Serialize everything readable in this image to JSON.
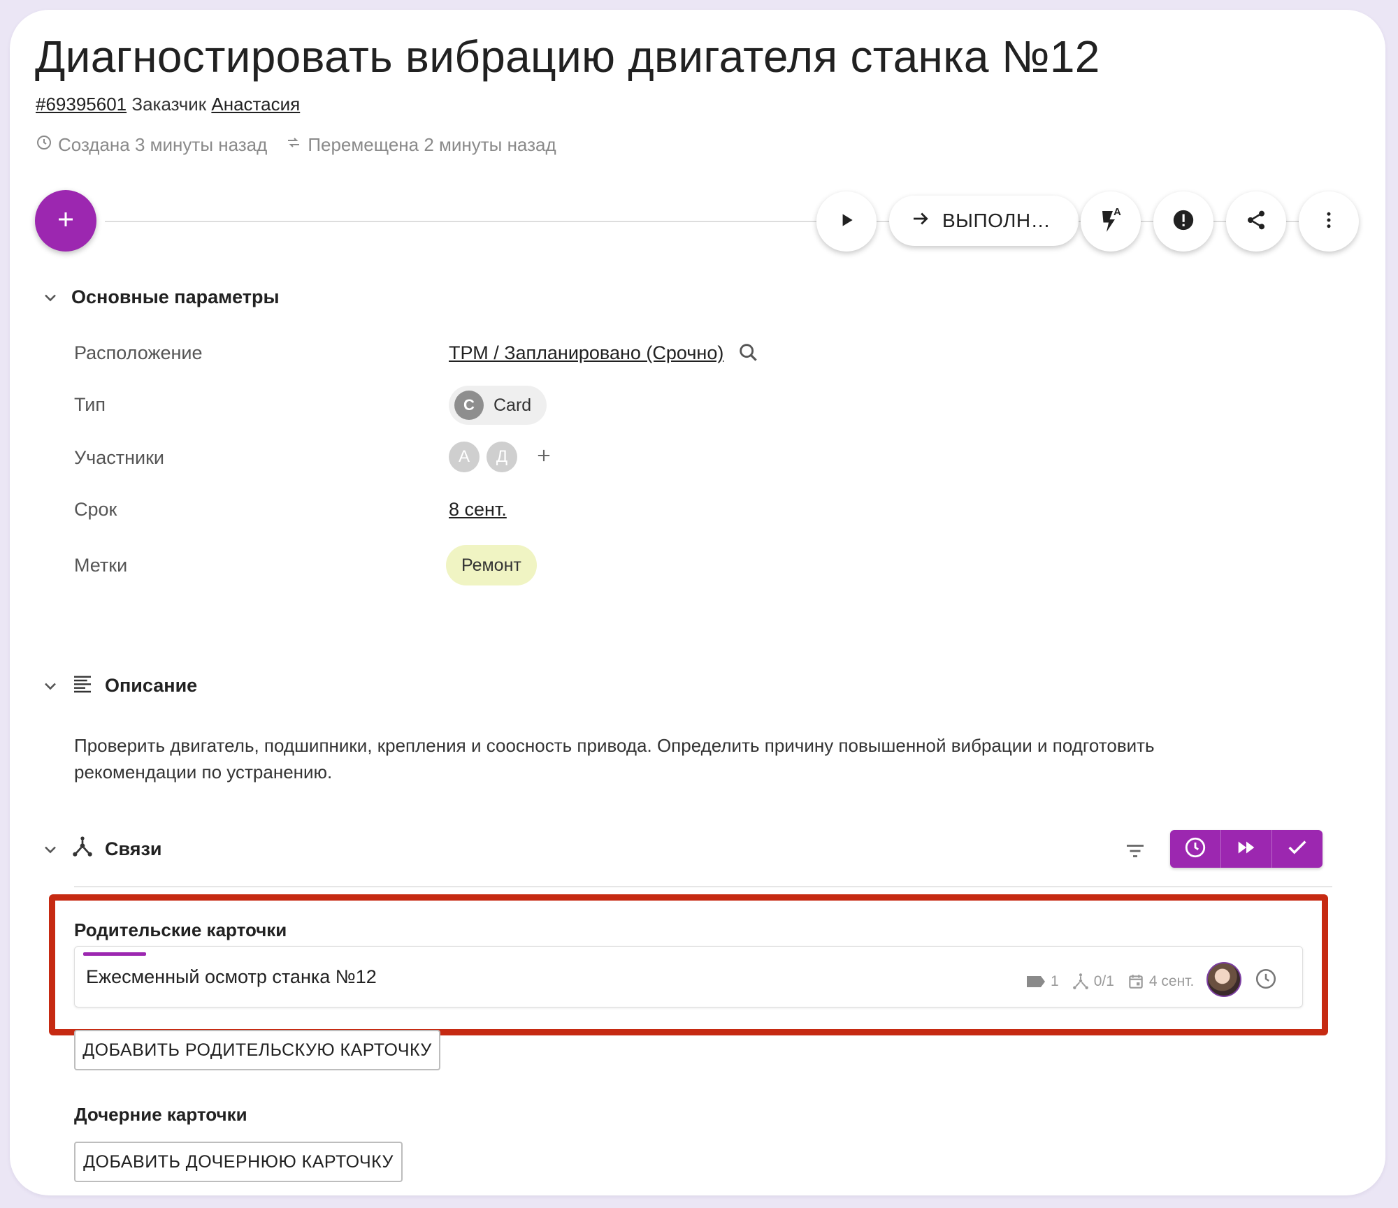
{
  "header": {
    "title": "Диагностировать вибрацию двигателя станка №12",
    "card_id": "#69395601",
    "customer_label": "Заказчик",
    "customer_name": "Анастасия",
    "created": "Создана 3 минуты назад",
    "moved": "Перемещена 2 минуты назад"
  },
  "toolbar": {
    "move_label": "ВЫПОЛН…",
    "flash_superscript": "A"
  },
  "main_params": {
    "section_title": "Основные параметры",
    "location_label": "Расположение",
    "location_value": "ТРМ / Запланировано (Срочно)",
    "type_label": "Тип",
    "type_initial": "C",
    "type_value": "Card",
    "members_label": "Участники",
    "members": [
      "А",
      "Д"
    ],
    "due_label": "Срок",
    "due_value": "8 сент.",
    "tags_label": "Метки",
    "tags": [
      "Ремонт"
    ]
  },
  "description": {
    "section_title": "Описание",
    "text_line1": "Проверить двигатель, подшипники, крепления и соосность привода. Определить причину повышенной вибрации и подготовить",
    "text_line2": "рекомендации по устранению."
  },
  "links": {
    "section_title": "Связи",
    "parent_heading": "Родительские карточки",
    "parent_card": {
      "title": "Ежесменный осмотр станка №12",
      "tags_count": "1",
      "children": "0/1",
      "date": "4 сент."
    },
    "add_parent_label": "ДОБАВИТЬ РОДИТЕЛЬСКУЮ КАРТОЧКУ",
    "child_heading": "Дочерние карточки",
    "add_child_label": "ДОБАВИТЬ ДОЧЕРНЮЮ КАРТОЧКУ"
  },
  "colors": {
    "accent": "#9c27b0",
    "highlight": "#c62a12",
    "tag_bg": "#f0f4c3"
  }
}
